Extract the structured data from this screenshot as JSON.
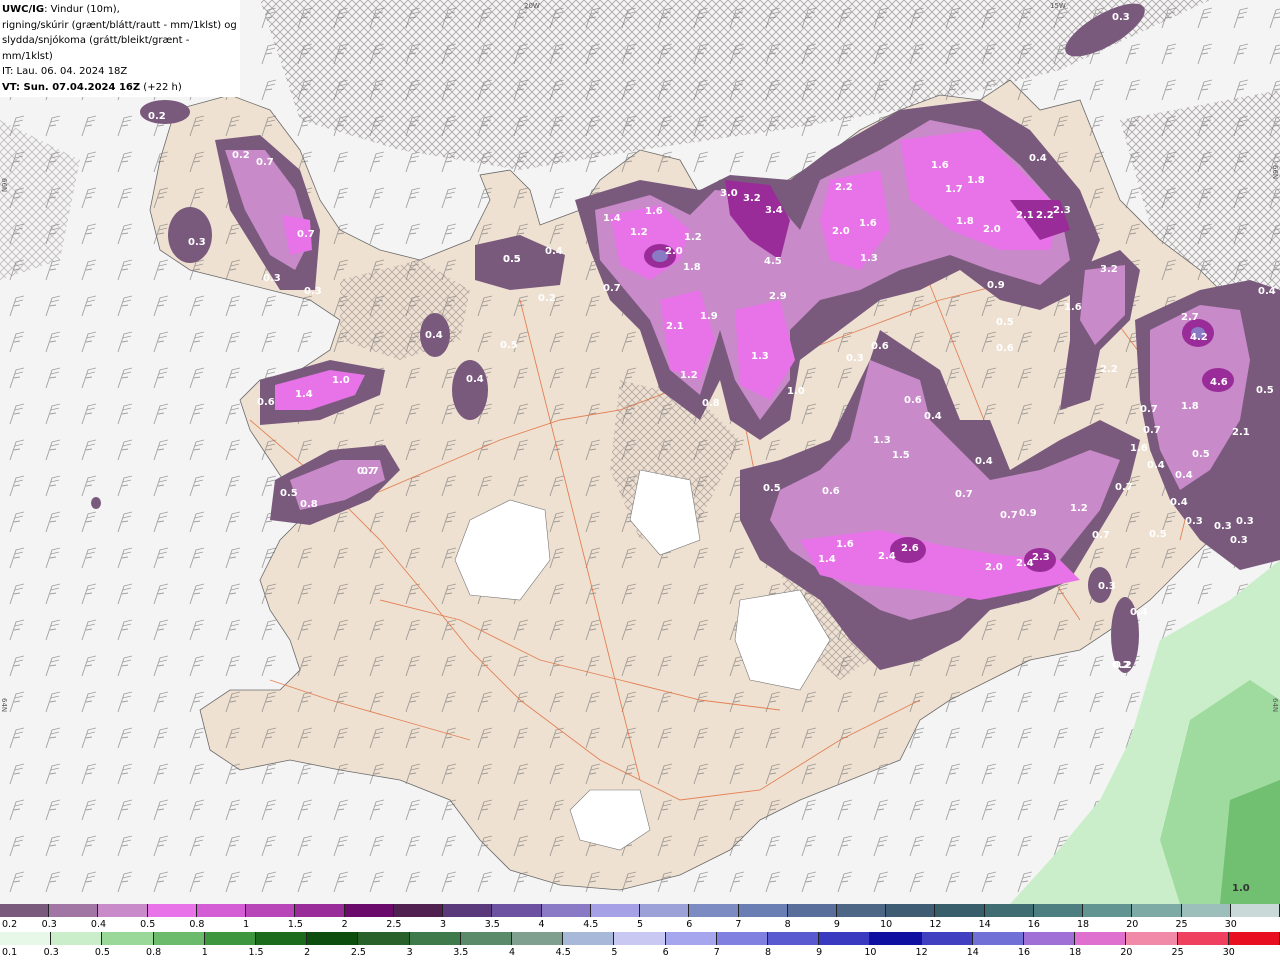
{
  "header": {
    "line1_bold": "UWC/IG",
    "line1_rest": ": Vindur (10m),",
    "line2": "rigning/skúrir (grænt/blátt/rautt - mm/1klst) og",
    "line3": "slydda/snjókoma (grátt/bleikt/grænt - mm/1klst)",
    "line4": "IT: Lau. 06. 04. 2024 18Z",
    "line5_bold": "VT: Sun. 07.04.2024 16Z",
    "line5_rest": " (+22 h)"
  },
  "map_edges": {
    "top_left": "20W",
    "top_right": "15W",
    "left_upper": "66N",
    "left_lower": "64N",
    "right_upper": "66N",
    "right_lower": "64N"
  },
  "precip_labels": [
    "0.3",
    "0.2",
    "0.2",
    "0.5",
    "0.7",
    "0.7",
    "0.3",
    "0.3",
    "0.3",
    "1.4",
    "1.6",
    "1.2",
    "0.5",
    "0.4",
    "0.2",
    "3.0",
    "3.2",
    "3.4",
    "0.7",
    "2.0",
    "1.8",
    "1.2",
    "2.1",
    "1.9",
    "1.2",
    "0.8",
    "0.7",
    "0.4",
    "0.6",
    "1.4",
    "1.0",
    "0.4",
    "0.5",
    "0.8",
    "0.7",
    "0.5",
    "0.4",
    "0.2",
    "2.2",
    "2.0",
    "1.6",
    "1.3",
    "4.5",
    "2.9",
    "1.3",
    "1.0",
    "1.6",
    "1.7",
    "1.8",
    "1.8",
    "2.0",
    "2.1",
    "2.2",
    "2.3",
    "0.4",
    "0.9",
    "0.5",
    "0.6",
    "1.6",
    "3.2",
    "0.3",
    "0.6",
    "0.6",
    "0.4",
    "1.3",
    "1.5",
    "0.4",
    "0.5",
    "0.6",
    "0.7",
    "2.2",
    "0.7",
    "1.6",
    "0.7",
    "2.7",
    "4.2",
    "4.6",
    "1.8",
    "2.1",
    "0.5",
    "0.4",
    "0.7",
    "0.4",
    "0.5",
    "1.2",
    "0.9",
    "0.7",
    "0.3",
    "0.3",
    "0.3",
    "0.3",
    "1.6",
    "1.4",
    "2.4",
    "2.6",
    "2.0",
    "2.4",
    "2.3",
    "0.7",
    "0.4",
    "0.3",
    "0.2",
    "0.4",
    "0.5",
    "1.0"
  ],
  "legend_snow": {
    "labels": [
      "0.2",
      "0.3",
      "0.4",
      "0.5",
      "0.8",
      "1",
      "1.5",
      "2",
      "2.5",
      "3",
      "3.5",
      "4",
      "4.5",
      "5",
      "6",
      "7",
      "8",
      "9",
      "10",
      "12",
      "14",
      "16",
      "18",
      "20",
      "25",
      "30"
    ],
    "colors": [
      "#7a5a7c",
      "#a176a4",
      "#c88ac9",
      "#e873e8",
      "#d45cd4",
      "#b946b9",
      "#9a2c9a",
      "#6a0a6a",
      "#502050",
      "#5a3a7a",
      "#6c52a0",
      "#8a7ac6",
      "#a6a0e6",
      "#9ca2d8",
      "#7c8cc2",
      "#6a7eb4",
      "#5a6e9c",
      "#4e6686",
      "#3e5c74",
      "#375e6a",
      "#3f6d72",
      "#4d7f80",
      "#629592",
      "#7eaaa6",
      "#9cbfbc",
      "#c9d9d8"
    ]
  },
  "legend_rain": {
    "labels": [
      "0.1",
      "0.3",
      "0.5",
      "0.8",
      "1",
      "1.5",
      "2",
      "2.5",
      "3",
      "3.5",
      "4",
      "4.5",
      "5",
      "6",
      "7",
      "8",
      "9",
      "10",
      "12",
      "14",
      "16",
      "18",
      "20",
      "25",
      "30"
    ],
    "colors": [
      "#e8f8e8",
      "#c9eec9",
      "#9ad89a",
      "#6cbb6c",
      "#3e963e",
      "#1c6a1c",
      "#0d4d0d",
      "#2a602a",
      "#3f7a4a",
      "#5a8a6a",
      "#7fa08f",
      "#a7b8d8",
      "#c8c8f2",
      "#a6a6ee",
      "#8080e0",
      "#5a5ad0",
      "#3a3ac0",
      "#1010a0",
      "#4040c0",
      "#7070d6",
      "#a070d6",
      "#e070d0",
      "#f08aa8",
      "#f04060",
      "#e81020"
    ]
  }
}
